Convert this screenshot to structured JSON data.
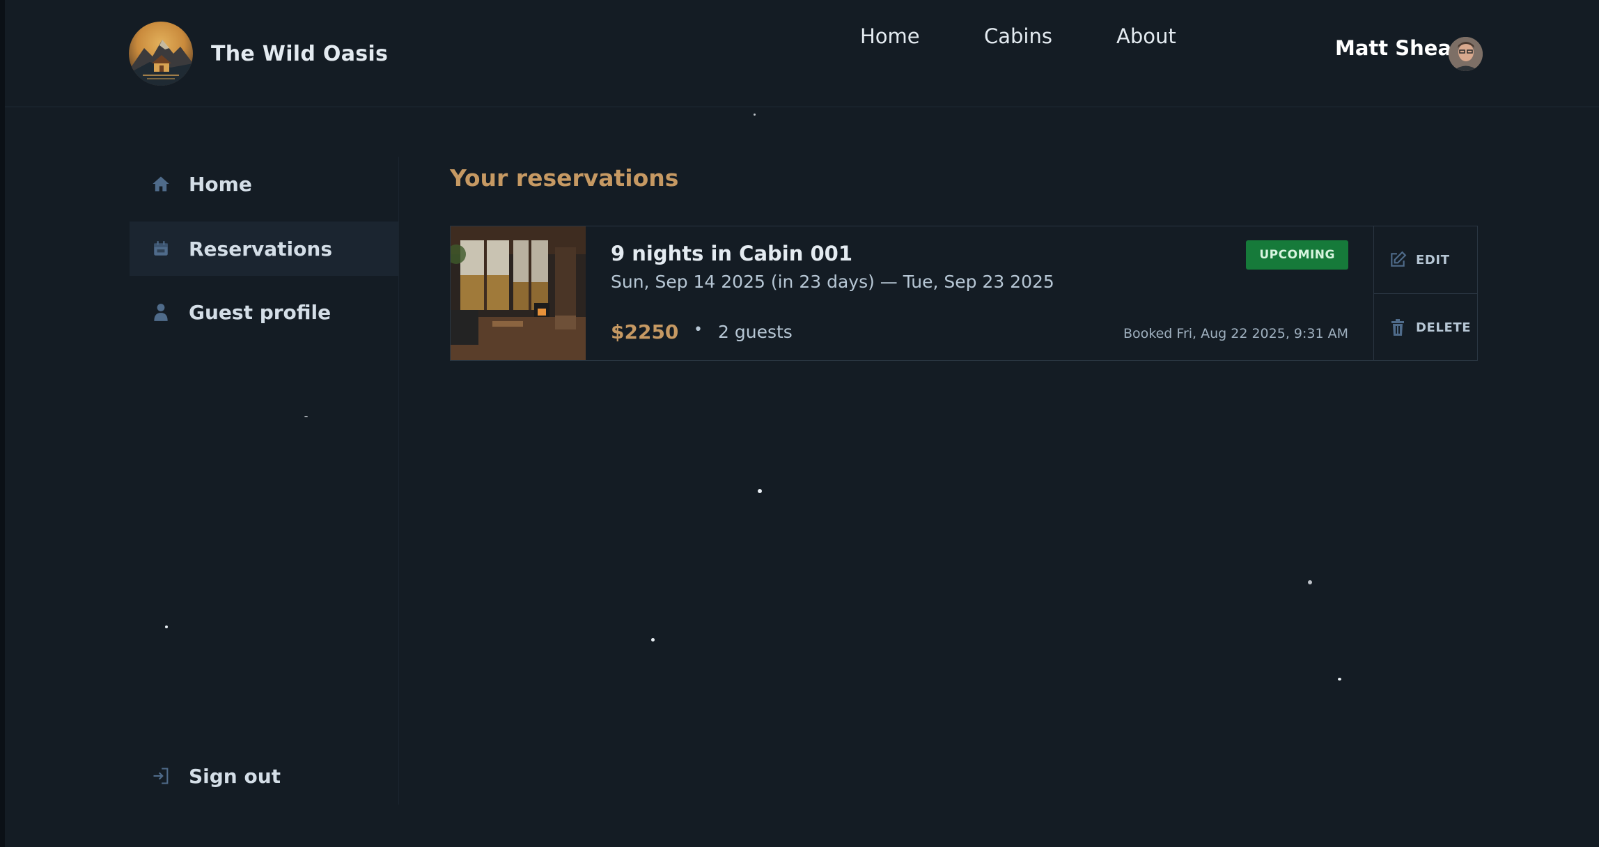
{
  "brand": {
    "name": "The Wild Oasis"
  },
  "nav": {
    "items": [
      {
        "label": "Home"
      },
      {
        "label": "Cabins"
      },
      {
        "label": "About"
      }
    ]
  },
  "user": {
    "name": "Matt Shea"
  },
  "sidebar": {
    "items": [
      {
        "label": "Home",
        "icon": "home-icon"
      },
      {
        "label": "Reservations",
        "icon": "calendar-icon",
        "active": true
      },
      {
        "label": "Guest profile",
        "icon": "user-icon"
      }
    ],
    "signout": {
      "label": "Sign out",
      "icon": "sign-out-icon"
    }
  },
  "main": {
    "title": "Your reservations",
    "reservations": [
      {
        "title": "9 nights in Cabin 001",
        "dates": "Sun, Sep 14 2025 (in 23 days) — Tue, Sep 23 2025",
        "price": "$2250",
        "separator": "•",
        "guests": "2 guests",
        "booked": "Booked Fri, Aug 22 2025, 9:31 AM",
        "status": "UPCOMING",
        "edit_label": "EDIT",
        "delete_label": "DELETE"
      }
    ]
  },
  "colors": {
    "background": "#141c24",
    "accent": "#c69963",
    "badge": "#167a3a",
    "text": "#d4dee7"
  }
}
